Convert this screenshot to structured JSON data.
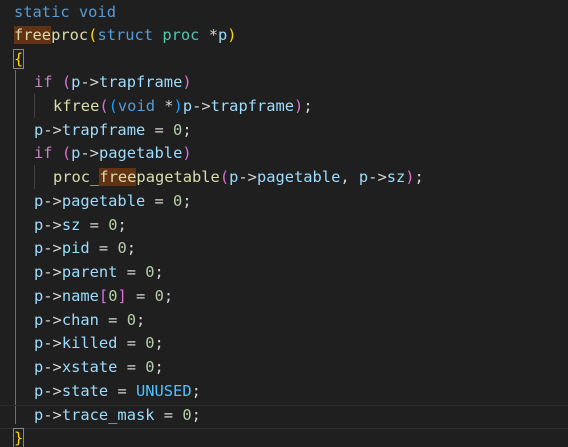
{
  "code": {
    "line1": {
      "kw_static": "static",
      "kw_void": "void"
    },
    "line2": {
      "fn_name_hl": "free",
      "fn_name_rest": "proc",
      "paren_open": "(",
      "kw_struct": "struct",
      "type_proc": "proc",
      "ptr": "*",
      "param": "p",
      "paren_close": ")"
    },
    "line3": {
      "brace": "{"
    },
    "line4": {
      "kw_if": "if",
      "paren_open": "(",
      "var_p": "p",
      "arrow": "->",
      "field": "trapframe",
      "paren_close": ")"
    },
    "line5": {
      "fn_kfree": "kfree",
      "paren_open": "(",
      "cast_open": "(",
      "kw_void": "void",
      "star": " *",
      "cast_close": ")",
      "var_p": "p",
      "arrow": "->",
      "field": "trapframe",
      "paren_close": ")",
      "semi": ";"
    },
    "line6": {
      "var_p": "p",
      "arrow": "->",
      "field": "trapframe",
      "assign": " = ",
      "value": "0",
      "semi": ";"
    },
    "line7": {
      "kw_if": "if",
      "paren_open": "(",
      "var_p": "p",
      "arrow": "->",
      "field": "pagetable",
      "paren_close": ")"
    },
    "line8": {
      "fn_pre": "proc_",
      "fn_hl": "free",
      "fn_post": "pagetable",
      "paren_open": "(",
      "var_p1": "p",
      "arrow1": "->",
      "field1": "pagetable",
      "comma": ", ",
      "var_p2": "p",
      "arrow2": "->",
      "field2": "sz",
      "paren_close": ")",
      "semi": ";"
    },
    "line9": {
      "var_p": "p",
      "arrow": "->",
      "field": "pagetable",
      "assign": " = ",
      "value": "0",
      "semi": ";"
    },
    "line10": {
      "var_p": "p",
      "arrow": "->",
      "field": "sz",
      "assign": " = ",
      "value": "0",
      "semi": ";"
    },
    "line11": {
      "var_p": "p",
      "arrow": "->",
      "field": "pid",
      "assign": " = ",
      "value": "0",
      "semi": ";"
    },
    "line12": {
      "var_p": "p",
      "arrow": "->",
      "field": "parent",
      "assign": " = ",
      "value": "0",
      "semi": ";"
    },
    "line13": {
      "var_p": "p",
      "arrow": "->",
      "field": "name",
      "idx_open": "[",
      "idx": "0",
      "idx_close": "]",
      "assign": " = ",
      "value": "0",
      "semi": ";"
    },
    "line14": {
      "var_p": "p",
      "arrow": "->",
      "field": "chan",
      "assign": " = ",
      "value": "0",
      "semi": ";"
    },
    "line15": {
      "var_p": "p",
      "arrow": "->",
      "field": "killed",
      "assign": " = ",
      "value": "0",
      "semi": ";"
    },
    "line16": {
      "var_p": "p",
      "arrow": "->",
      "field": "xstate",
      "assign": " = ",
      "value": "0",
      "semi": ";"
    },
    "line17": {
      "var_p": "p",
      "arrow": "->",
      "field": "state",
      "assign": " = ",
      "value": "UNUSED",
      "semi": ";"
    },
    "line18": {
      "var_p": "p",
      "arrow": "->",
      "field": "trace_mask",
      "assign": " = ",
      "value": "0",
      "semi": ";"
    },
    "line19": {
      "brace": "}"
    }
  },
  "colors": {
    "background": "#1f1f1f",
    "keyword": "#569cd6",
    "control": "#c586c0",
    "function": "#dcdcaa",
    "type": "#4ec9b0",
    "variable": "#9cdcfe",
    "number": "#b5cea8",
    "enum_member": "#4fc1ff",
    "bracket_level1": "#ffd700",
    "bracket_level2": "#da70d6",
    "bracket_level3": "#179fff",
    "word_highlight": "#613214"
  }
}
